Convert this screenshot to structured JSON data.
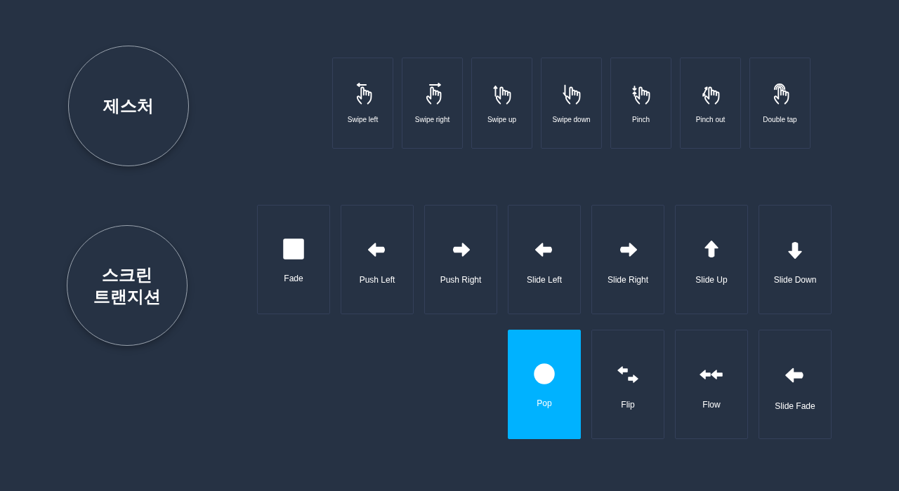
{
  "sections": [
    {
      "kind": "gestures",
      "title": "제스처",
      "cards": [
        {
          "label": "Swipe left",
          "kind": "swipe-left"
        },
        {
          "label": "Swipe right",
          "kind": "swipe-right"
        },
        {
          "label": "Swipe up",
          "kind": "swipe-up"
        },
        {
          "label": "Swipe down",
          "kind": "swipe-down"
        },
        {
          "label": "Pinch",
          "kind": "pinch"
        },
        {
          "label": "Pinch out",
          "kind": "pinch-out"
        },
        {
          "label": "Double tap",
          "kind": "double-tap"
        }
      ]
    },
    {
      "kind": "transitions",
      "title": "스크린 트랜지션",
      "cards": [
        {
          "label": "Fade",
          "kind": "square",
          "selected": false
        },
        {
          "label": "Push Left",
          "kind": "arrow-left",
          "selected": false
        },
        {
          "label": "Push Right",
          "kind": "arrow-right",
          "selected": false
        },
        {
          "label": "Slide Left",
          "kind": "arrow-left",
          "selected": false
        },
        {
          "label": "Slide Right",
          "kind": "arrow-right",
          "selected": false
        },
        {
          "label": "Slide Up",
          "kind": "arrow-up",
          "selected": false
        },
        {
          "label": "Slide Down",
          "kind": "arrow-down",
          "selected": false
        },
        {
          "label": "Pop",
          "kind": "circle",
          "selected": true
        },
        {
          "label": "Flip",
          "kind": "flip",
          "selected": false
        },
        {
          "label": "Flow",
          "kind": "flow",
          "selected": false
        },
        {
          "label": "Slide Fade",
          "kind": "arrow-left-large",
          "selected": false
        }
      ]
    }
  ]
}
